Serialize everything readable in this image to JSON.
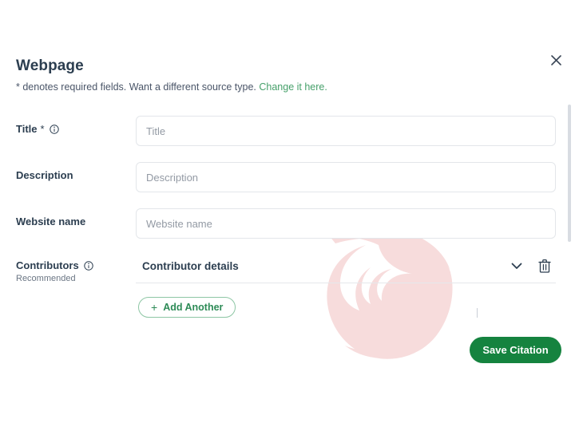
{
  "window": {
    "close_label": "×"
  },
  "header": {
    "title": "Webpage",
    "subtitle_text": "* denotes required fields. Want a different source type.",
    "subtitle_link": "Change it here."
  },
  "form": {
    "fields": [
      {
        "label": "Title",
        "required_marker": "*",
        "info_icon": "info-circle-icon",
        "placeholder": "Title",
        "value": ""
      },
      {
        "label": "Description",
        "required_marker": "",
        "info_icon": "",
        "placeholder": "Description",
        "value": ""
      },
      {
        "label": "Website name",
        "required_marker": "",
        "info_icon": "",
        "placeholder": "Website name",
        "value": ""
      }
    ],
    "contributors": {
      "label": "Contributors",
      "info_icon": "info-circle-icon",
      "sublabel": "Recommended",
      "panel_title": "Contributor details",
      "collapse_icon": "chevron-down-icon",
      "delete_icon": "trash-icon",
      "add_another_label": "Add Another",
      "add_another_plus": "+"
    }
  },
  "actions": {
    "save_label": "Save Citation"
  },
  "colors": {
    "accent_green": "#15833f",
    "link_green": "#46a06a",
    "text_navy": "#2c3e50",
    "placeholder_gray": "#939aa4",
    "border_gray": "#e3e6ea",
    "watermark_pink": "#f7dcdc",
    "scrollbar_gray": "#d8dce2"
  }
}
